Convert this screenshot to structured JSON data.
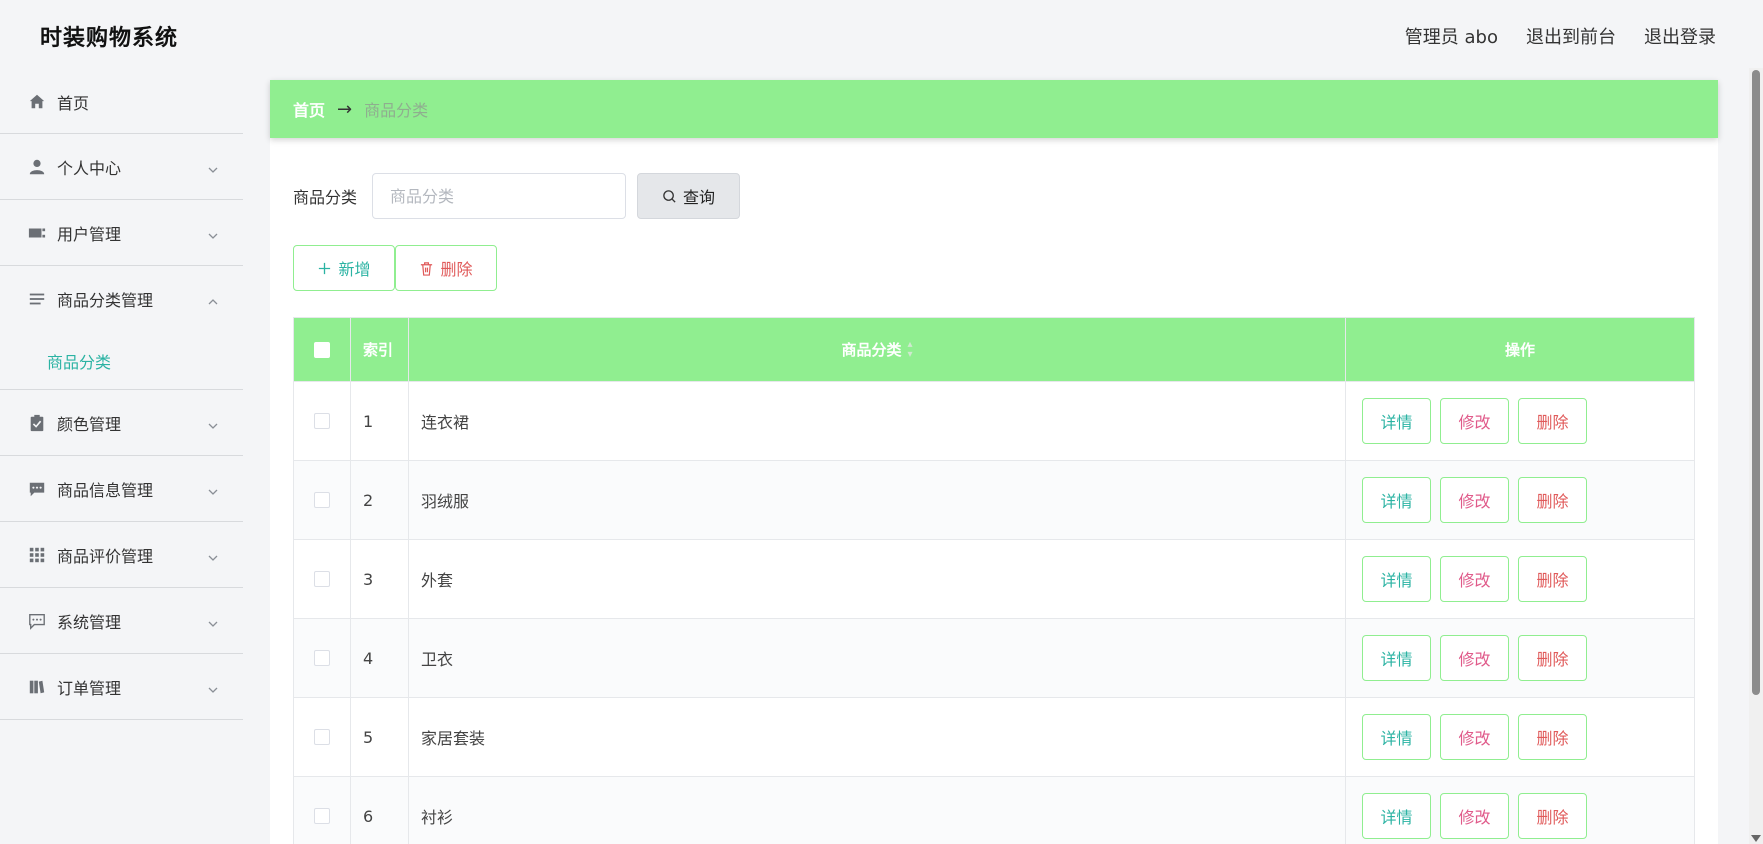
{
  "app": {
    "title": "时装购物系统"
  },
  "topnav": {
    "user": "管理员 abo",
    "to_front": "退出到前台",
    "logout": "退出登录"
  },
  "sidebar": {
    "items": [
      {
        "label": "首页",
        "icon": "home-icon"
      },
      {
        "label": "个人中心",
        "icon": "user-icon"
      },
      {
        "label": "用户管理",
        "icon": "users-card-icon"
      },
      {
        "label": "商品分类管理",
        "icon": "list-icon"
      },
      {
        "label": "颜色管理",
        "icon": "clipboard-icon"
      },
      {
        "label": "商品信息管理",
        "icon": "chat-icon"
      },
      {
        "label": "商品评价管理",
        "icon": "grid-icon"
      },
      {
        "label": "系统管理",
        "icon": "message-icon"
      },
      {
        "label": "订单管理",
        "icon": "book-icon"
      }
    ],
    "submenu": {
      "label": "商品分类"
    }
  },
  "breadcrumb": {
    "home": "首页",
    "arrow": "→",
    "current": "商品分类"
  },
  "search": {
    "label": "商品分类",
    "placeholder": "商品分类",
    "value": "",
    "button": "查询"
  },
  "actions": {
    "add": "新增",
    "delete": "删除"
  },
  "table": {
    "headers": {
      "index": "索引",
      "name": "商品分类",
      "ops": "操作"
    },
    "rows": [
      {
        "index": "1",
        "name": "连衣裙"
      },
      {
        "index": "2",
        "name": "羽绒服"
      },
      {
        "index": "3",
        "name": "外套"
      },
      {
        "index": "4",
        "name": "卫衣"
      },
      {
        "index": "5",
        "name": "家居套装"
      },
      {
        "index": "6",
        "name": "衬衫"
      }
    ],
    "ops": {
      "detail": "详情",
      "edit": "修改",
      "delete": "删除"
    }
  },
  "colors": {
    "accent": "#90ee90",
    "teal": "#2bb3a3",
    "danger": "#e05a5a"
  }
}
